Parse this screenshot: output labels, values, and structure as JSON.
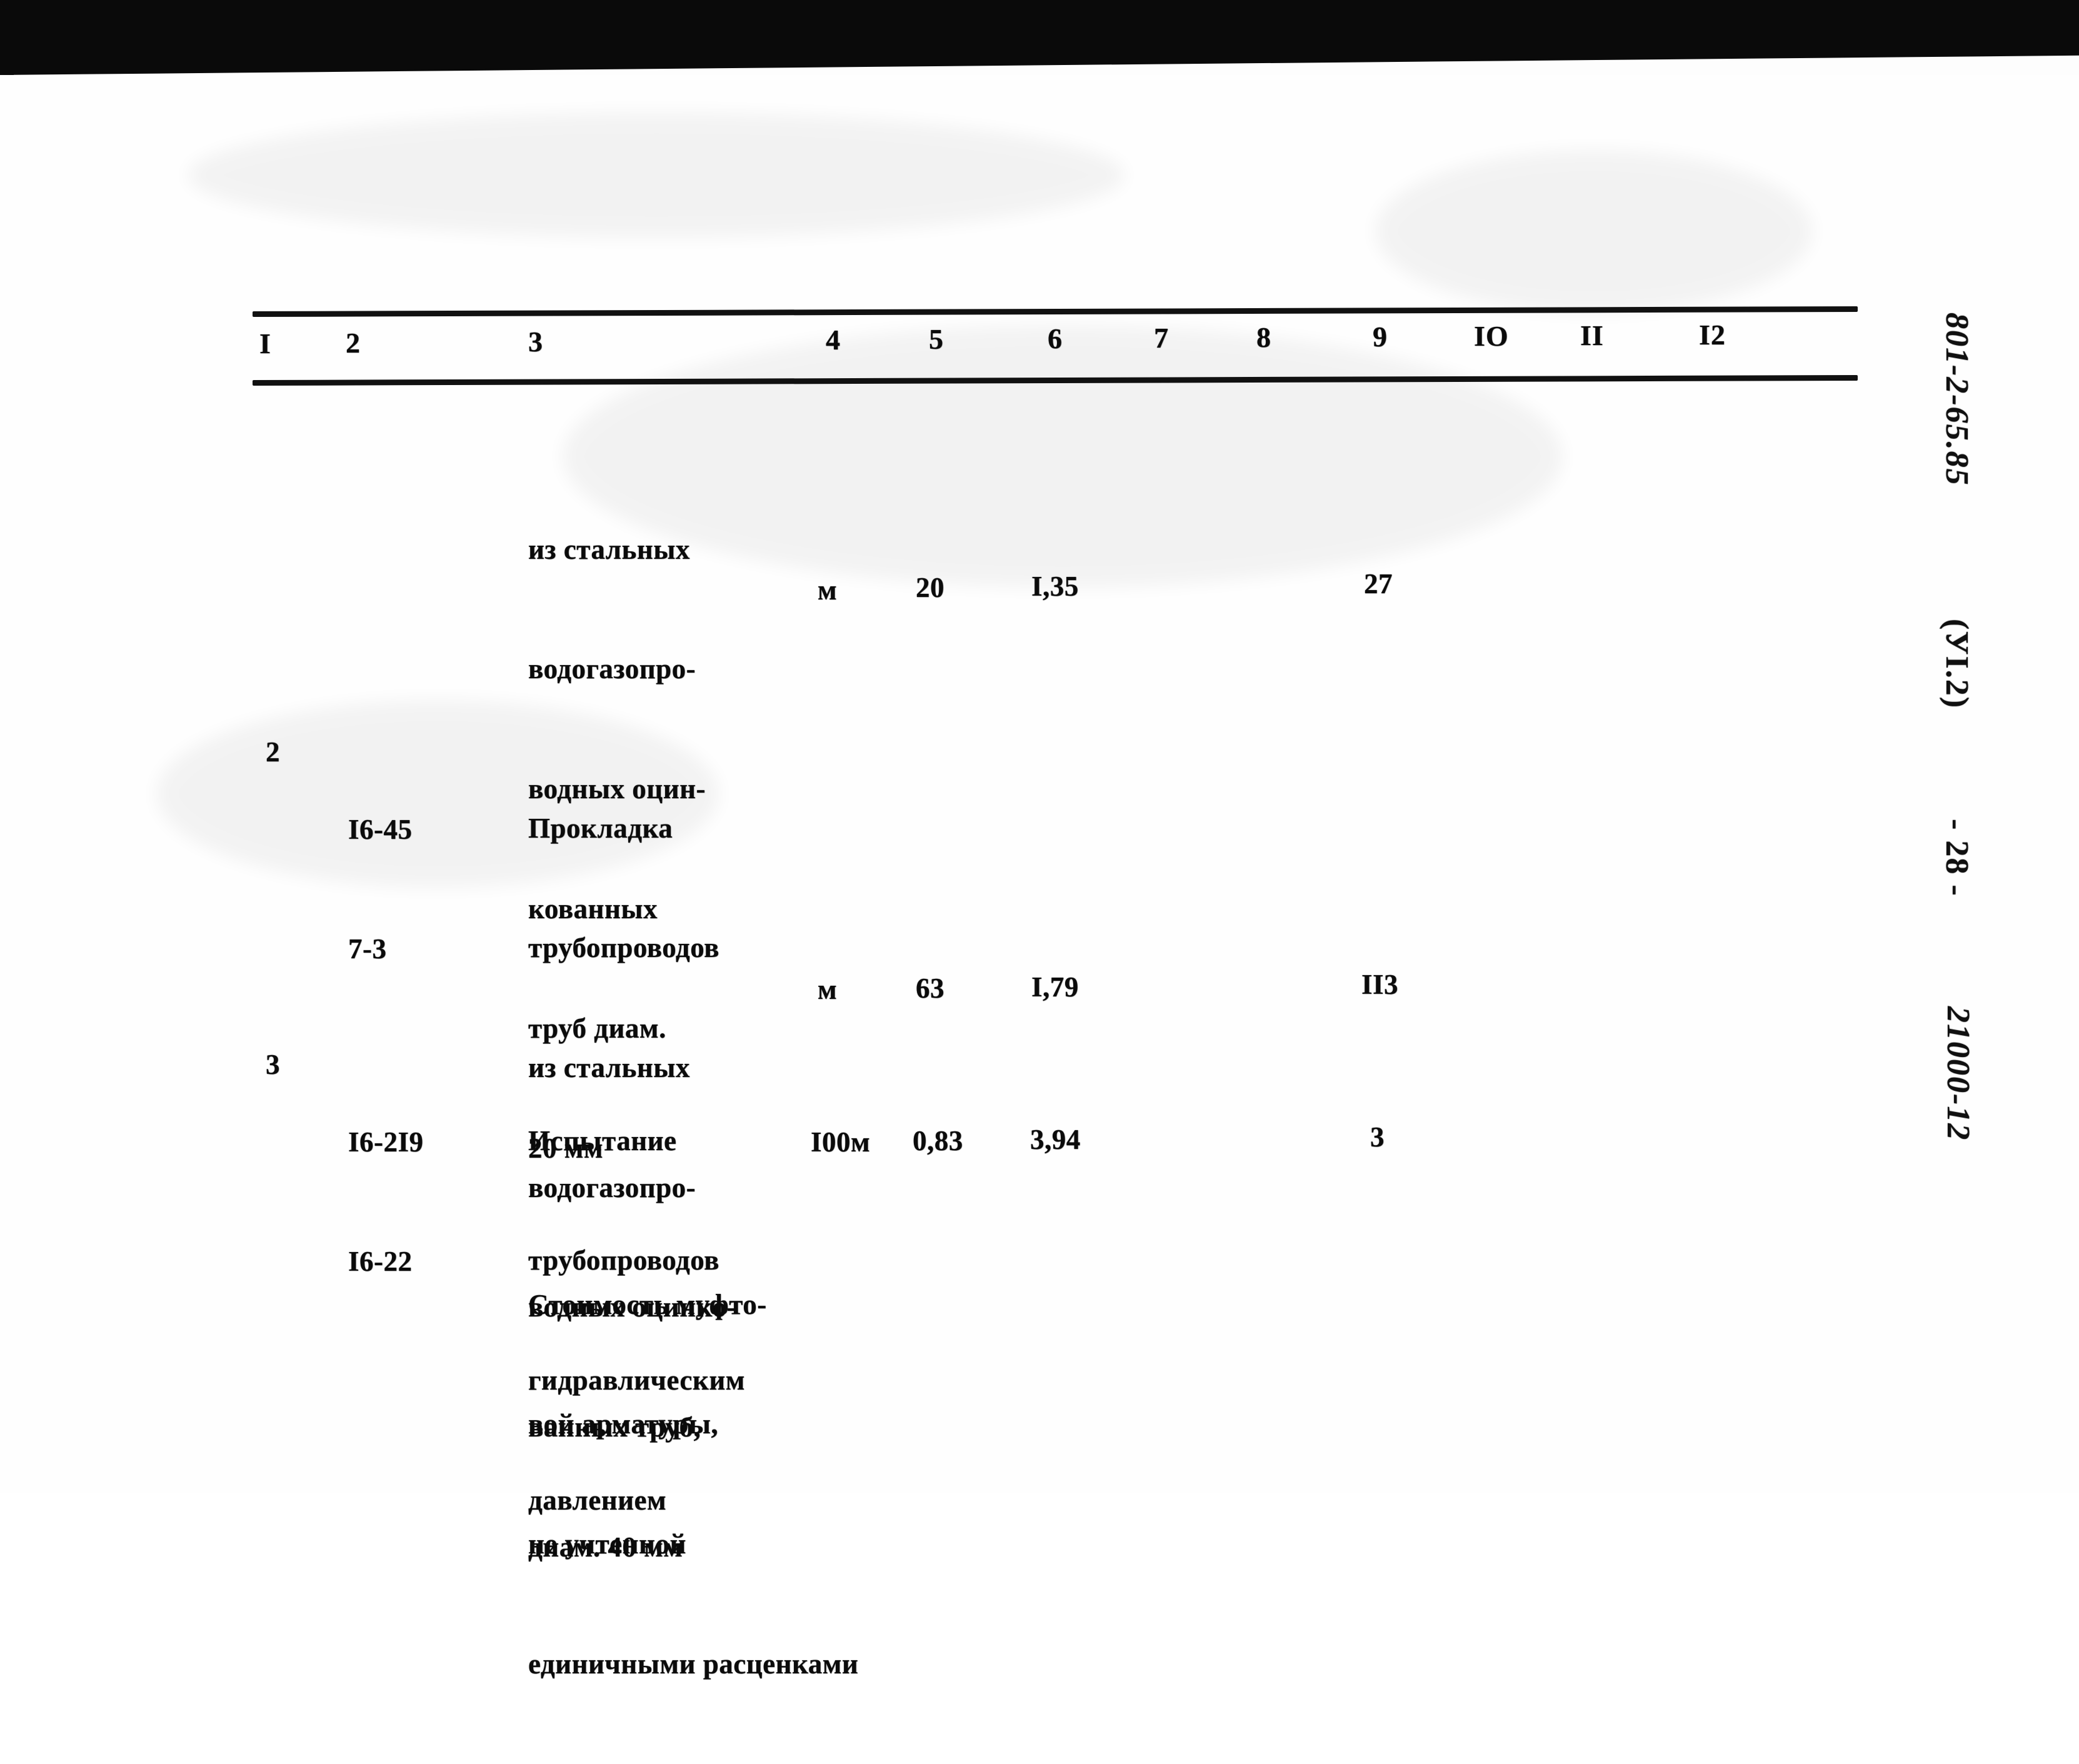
{
  "document": {
    "kind": "scanned-cost-estimate-table",
    "language": "ru"
  },
  "table": {
    "column_headers": [
      "I",
      "2",
      "3",
      "4",
      "5",
      "6",
      "7",
      "8",
      "9",
      "IO",
      "II",
      "I2"
    ],
    "rows": [
      {
        "no": "",
        "code": "",
        "description_lines": [
          "из стальных",
          "водогазопро-",
          "водных оцин-",
          "кованных",
          "труб диам.",
          "20 мм"
        ],
        "unit": "м",
        "col5": "20",
        "col6": "I,35",
        "col7": "",
        "col8": "",
        "col9": "27",
        "col10": "",
        "col11": "",
        "col12": ""
      },
      {
        "no": "2",
        "code_lines": [
          "I6-45",
          "7-3"
        ],
        "description_lines": [
          "Прокладка",
          "трубопроводов",
          "из стальных",
          "водогазопро-",
          "водных оцинко-",
          "ванных труб,",
          "диам. 40 мм"
        ],
        "unit": "м",
        "col5": "63",
        "col6": "I,79",
        "col7": "",
        "col8": "",
        "col9": "II3",
        "col10": "",
        "col11": "",
        "col12": ""
      },
      {
        "no": "3",
        "code_lines": [
          "I6-2I9",
          "I6-22"
        ],
        "description_lines": [
          "Испытание",
          "трубопроводов",
          "гидравлическим",
          "давлением"
        ],
        "unit": "I00м",
        "col5": "0,83",
        "col6": "3,94",
        "col7": "",
        "col8": "",
        "col9": "3",
        "col10": "",
        "col11": "",
        "col12": ""
      }
    ],
    "footnote_lines": [
      "Стоимость муфто-",
      "вой арматуры,",
      "не учтенной",
      "единичными расценками"
    ]
  },
  "margin_notes": {
    "catalog_code": "801-2-65.85",
    "section": "(УI.2)",
    "page_number": "- 28 -",
    "archive_code": "21000-12"
  },
  "colors": {
    "ink": "#0b0b0b",
    "paper": "#fefefe",
    "scan_edge": "#0a0a0a"
  }
}
